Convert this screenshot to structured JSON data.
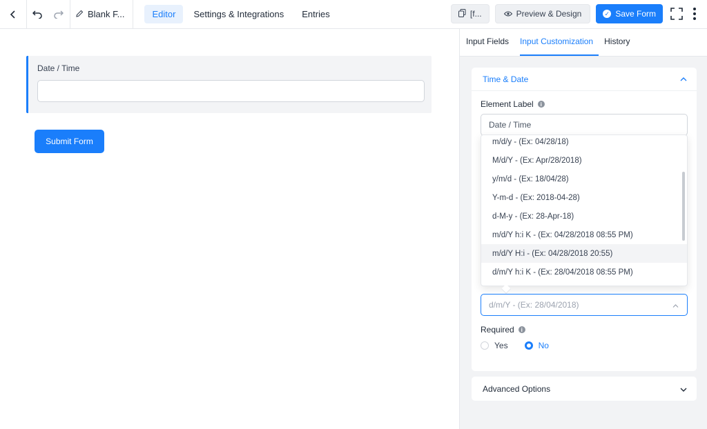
{
  "topbar": {
    "form_title": "Blank F...",
    "tabs": [
      {
        "label": "Editor",
        "active": true
      },
      {
        "label": "Settings & Integrations",
        "active": false
      },
      {
        "label": "Entries",
        "active": false
      }
    ],
    "shortcode_label": "[f...",
    "preview_label": "Preview & Design",
    "save_label": "Save Form"
  },
  "canvas": {
    "field_label": "Date / Time",
    "submit_label": "Submit Form"
  },
  "panel": {
    "tabs": [
      {
        "label": "Input Fields",
        "active": false
      },
      {
        "label": "Input Customization",
        "active": true
      },
      {
        "label": "History",
        "active": false
      }
    ],
    "section_title": "Time & Date",
    "element_label_title": "Element Label",
    "element_label_value": "Date / Time",
    "date_format_options": [
      "m/d/y - (Ex: 04/28/18)",
      "M/d/Y - (Ex: Apr/28/2018)",
      "y/m/d - (Ex: 18/04/28)",
      "Y-m-d - (Ex: 2018-04-28)",
      "d-M-y - (Ex: 28-Apr-18)",
      "m/d/Y h:i K - (Ex: 04/28/2018 08:55 PM)",
      "m/d/Y H:i - (Ex: 04/28/2018 20:55)",
      "d/m/Y h:i K - (Ex: 28/04/2018 08:55 PM)"
    ],
    "hovered_option_index": 6,
    "date_format_value": "d/m/Y - (Ex: 28/04/2018)",
    "required_title": "Required",
    "required_options": [
      {
        "label": "Yes",
        "selected": false
      },
      {
        "label": "No",
        "selected": true
      }
    ],
    "advanced_title": "Advanced Options"
  },
  "colors": {
    "accent": "#1a7efb",
    "panel_bg": "#f2f3f5"
  }
}
